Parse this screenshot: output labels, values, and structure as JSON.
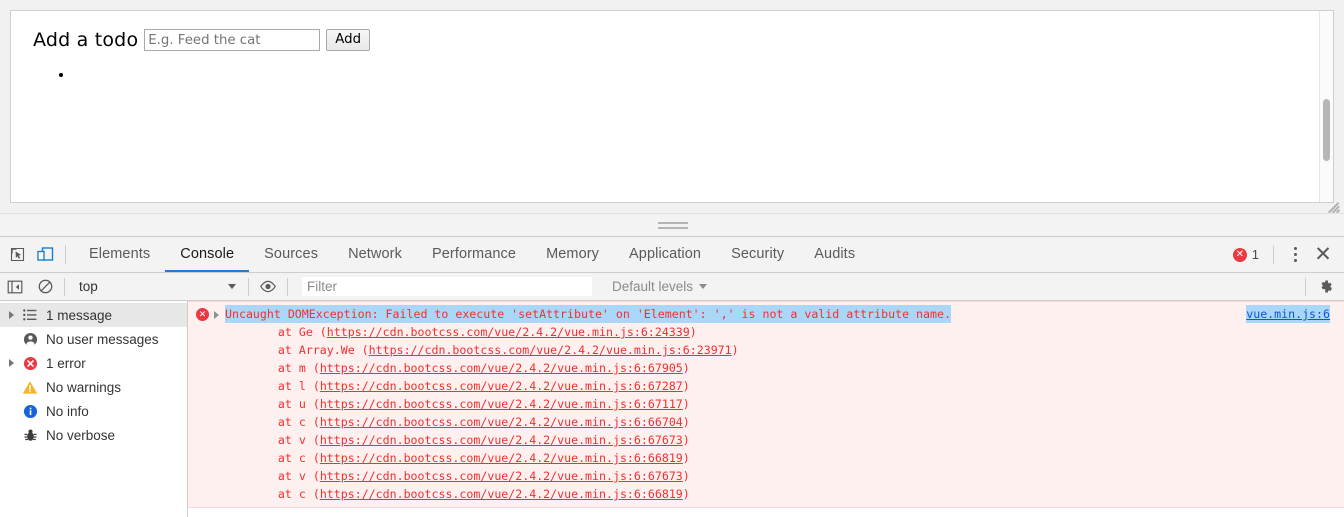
{
  "page": {
    "todo_label": "Add a todo",
    "todo_input_value": "",
    "todo_input_placeholder": "E.g. Feed the cat",
    "add_button_label": "Add",
    "todo_items": [
      ""
    ]
  },
  "devtools": {
    "toolbar": {
      "inspect_icon": "inspect-element-icon",
      "device_icon": "device-toolbar-icon",
      "tabs": [
        {
          "label": "Elements",
          "active": false
        },
        {
          "label": "Console",
          "active": true
        },
        {
          "label": "Sources",
          "active": false
        },
        {
          "label": "Network",
          "active": false
        },
        {
          "label": "Performance",
          "active": false
        },
        {
          "label": "Memory",
          "active": false
        },
        {
          "label": "Application",
          "active": false
        },
        {
          "label": "Security",
          "active": false
        },
        {
          "label": "Audits",
          "active": false
        }
      ],
      "error_count": "1",
      "error_glyph": "✕",
      "more_options_icon": "kebab-menu-icon",
      "close_icon": "✕"
    },
    "filterbar": {
      "sidebar_toggle_icon": "console-sidebar-toggle-icon",
      "clear_icon": "clear-console-icon",
      "context": "top",
      "eye_icon": "live-expression-eye-icon",
      "filter_value": "",
      "filter_placeholder": "Filter",
      "levels_label": "Default levels",
      "settings_icon": "settings-gear-icon"
    },
    "sidebar": [
      {
        "label": "1 message",
        "icon": "list-icon",
        "expandable": true,
        "selected": true
      },
      {
        "label": "No user messages",
        "icon": "user-icon",
        "expandable": false,
        "selected": false
      },
      {
        "label": "1 error",
        "icon": "error-icon",
        "expandable": true,
        "selected": false
      },
      {
        "label": "No warnings",
        "icon": "warning-icon",
        "expandable": false,
        "selected": false
      },
      {
        "label": "No info",
        "icon": "info-icon",
        "expandable": false,
        "selected": false
      },
      {
        "label": "No verbose",
        "icon": "bug-icon",
        "expandable": false,
        "selected": false
      }
    ],
    "console_message": {
      "headline": "Uncaught DOMException: Failed to execute 'setAttribute' on 'Element': ',' is not a valid attribute name.",
      "source_link": "vue.min.js:6",
      "stack": [
        {
          "fn": "    at Ge (",
          "url": "https://cdn.bootcss.com/vue/2.4.2/vue.min.js:6:24339",
          "close": ")"
        },
        {
          "fn": "    at Array.We (",
          "url": "https://cdn.bootcss.com/vue/2.4.2/vue.min.js:6:23971",
          "close": ")"
        },
        {
          "fn": "    at m (",
          "url": "https://cdn.bootcss.com/vue/2.4.2/vue.min.js:6:67905",
          "close": ")"
        },
        {
          "fn": "    at l (",
          "url": "https://cdn.bootcss.com/vue/2.4.2/vue.min.js:6:67287",
          "close": ")"
        },
        {
          "fn": "    at u (",
          "url": "https://cdn.bootcss.com/vue/2.4.2/vue.min.js:6:67117",
          "close": ")"
        },
        {
          "fn": "    at c (",
          "url": "https://cdn.bootcss.com/vue/2.4.2/vue.min.js:6:66704",
          "close": ")"
        },
        {
          "fn": "    at v (",
          "url": "https://cdn.bootcss.com/vue/2.4.2/vue.min.js:6:67673",
          "close": ")"
        },
        {
          "fn": "    at c (",
          "url": "https://cdn.bootcss.com/vue/2.4.2/vue.min.js:6:66819",
          "close": ")"
        },
        {
          "fn": "    at v (",
          "url": "https://cdn.bootcss.com/vue/2.4.2/vue.min.js:6:67673",
          "close": ")"
        },
        {
          "fn": "    at c (",
          "url": "https://cdn.bootcss.com/vue/2.4.2/vue.min.js:6:66819",
          "close": ")"
        }
      ]
    }
  },
  "colors": {
    "accent": "#1a7fd4",
    "error": "#eb3941",
    "error_text": "#f32f2f",
    "error_bg": "#fff0f0",
    "selection": "#aad6f8",
    "warning": "#f5a623",
    "info": "#1a73e8",
    "link": "#1155cc"
  }
}
